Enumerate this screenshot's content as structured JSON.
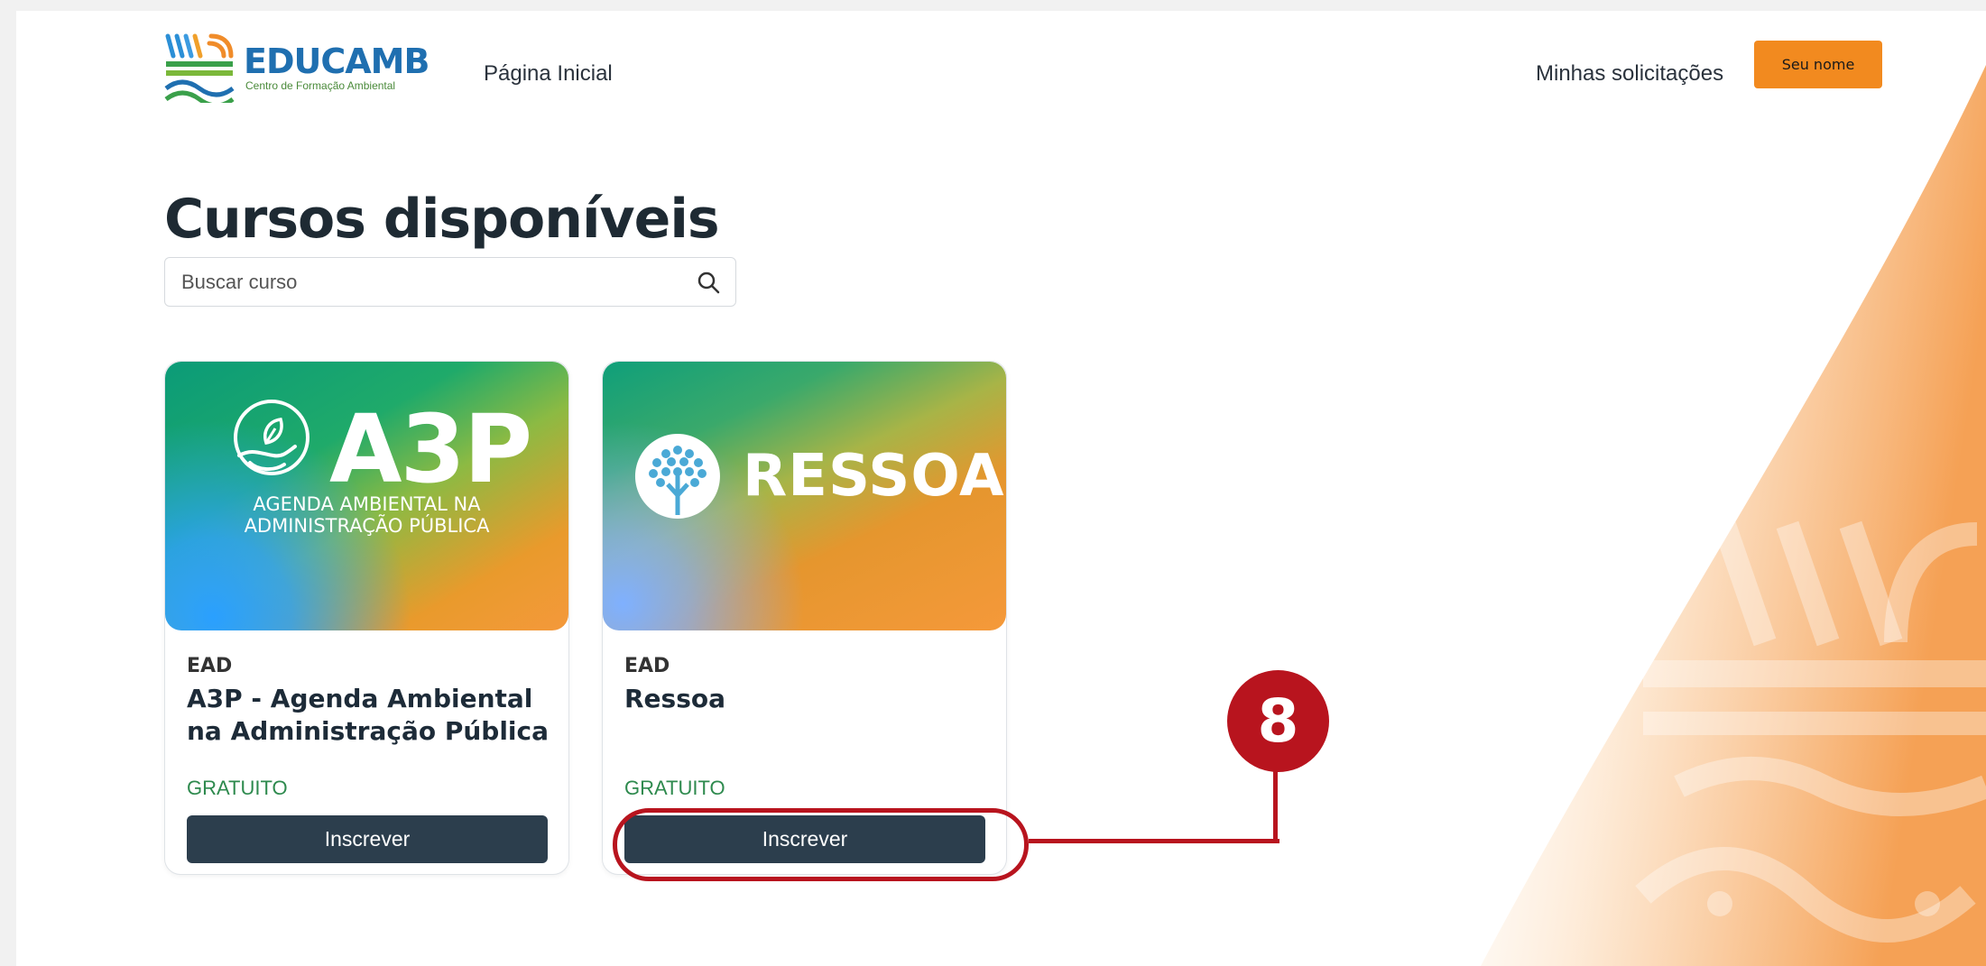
{
  "header": {
    "logo_name": "EDUCAMB",
    "logo_subtitle": "Centro de Formação Ambiental",
    "nav_home": "Página Inicial",
    "nav_requests": "Minhas solicitações",
    "user_button": "Seu nome"
  },
  "main": {
    "title": "Cursos disponíveis",
    "search": {
      "placeholder": "Buscar curso",
      "value": ""
    },
    "courses": [
      {
        "banner_title": "A3P",
        "banner_subtitle_line1": "AGENDA AMBIENTAL NA",
        "banner_subtitle_line2": "ADMINISTRAÇÃO PÚBLICA",
        "type": "EAD",
        "name": "A3P - Agenda Ambiental na Administração Pública",
        "price": "GRATUITO",
        "button": "Inscrever"
      },
      {
        "banner_title": "RESSOA",
        "type": "EAD",
        "name": "Ressoa",
        "price": "GRATUITO",
        "button": "Inscrever"
      }
    ]
  },
  "annotation": {
    "step_number": "8"
  },
  "colors": {
    "accent_orange": "#f28a1f",
    "button_dark": "#2c3e4d",
    "price_green": "#2e8a4e",
    "annotation_red": "#b8141e",
    "logo_blue": "#1f6fb0"
  },
  "icons": {
    "search": "search-icon",
    "logo": "educamb-logo-icon",
    "a3p_emblem": "hand-leaf-icon",
    "ressoa_emblem": "tree-icon"
  }
}
